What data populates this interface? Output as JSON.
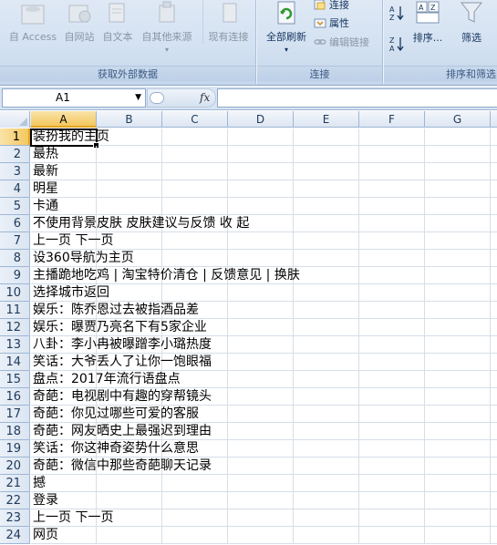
{
  "ribbon": {
    "external_data": {
      "group_label": "获取外部数据",
      "buttons": [
        {
          "label": "自 Access",
          "icon": "access-db-icon"
        },
        {
          "label": "自网站",
          "icon": "web-icon"
        },
        {
          "label": "自文本",
          "icon": "text-file-icon"
        },
        {
          "label": "自其他来源",
          "icon": "other-source-icon"
        },
        {
          "label": "现有连接",
          "icon": "existing-connection-icon"
        }
      ]
    },
    "connections": {
      "group_label": "连接",
      "refresh_all": "全部刷新",
      "connections_label": "连接",
      "properties_label": "属性",
      "edit_links_label": "编辑链接"
    },
    "sort_filter": {
      "group_label": "排序和筛选",
      "sort_label": "排序...",
      "filter_label": "筛选",
      "sort_asc_icon": "sort-a-z-icon",
      "sort_desc_icon": "sort-z-a-icon"
    }
  },
  "formula_bar": {
    "name_box": "A1",
    "fx_label": "fx",
    "formula": ""
  },
  "grid": {
    "columns": [
      "A",
      "B",
      "C",
      "D",
      "E",
      "F",
      "G"
    ],
    "selected_column": "A",
    "selected_row": 1,
    "rows": [
      {
        "num": "1",
        "a": "装扮我的主页"
      },
      {
        "num": "2",
        "a": "最热"
      },
      {
        "num": "3",
        "a": "最新"
      },
      {
        "num": "4",
        "a": "明星"
      },
      {
        "num": "5",
        "a": "卡通"
      },
      {
        "num": "6",
        "a": "不使用背景皮肤 皮肤建议与反馈 收 起"
      },
      {
        "num": "7",
        "a": "上一页 下一页"
      },
      {
        "num": "8",
        "a": "设360导航为主页"
      },
      {
        "num": "9",
        "a": "主播跪地吃鸡 | 淘宝特价清仓 | 反馈意见 | 换肤"
      },
      {
        "num": "10",
        "a": "选择城市返回"
      },
      {
        "num": "11",
        "a": "娱乐：陈乔恩过去被指酒品差"
      },
      {
        "num": "12",
        "a": "娱乐：曝贾乃亮名下有5家企业"
      },
      {
        "num": "13",
        "a": "八卦：李小冉被曝蹭李小璐热度"
      },
      {
        "num": "14",
        "a": "笑话：大爷丢人了让你一饱眼福"
      },
      {
        "num": "15",
        "a": "盘点：2017年流行语盘点"
      },
      {
        "num": "16",
        "a": "奇葩：电视剧中有趣的穿帮镜头"
      },
      {
        "num": "17",
        "a": "奇葩：你见过哪些可爱的客服"
      },
      {
        "num": "18",
        "a": "奇葩：网友晒史上最强迟到理由"
      },
      {
        "num": "19",
        "a": "笑话：你这神奇姿势什么意思"
      },
      {
        "num": "20",
        "a": "奇葩：微信中那些奇葩聊天记录"
      },
      {
        "num": "21",
        "a": "撼"
      },
      {
        "num": "22",
        "a": "登录"
      },
      {
        "num": "23",
        "a": "上一页 下一页"
      },
      {
        "num": "24",
        "a": "网页"
      }
    ]
  },
  "colors": {
    "ribbon_bg": "#d3e1f1",
    "selection_header": "#f3c85e",
    "grid_line": "#d6dee8",
    "header_text": "#1e395b"
  }
}
